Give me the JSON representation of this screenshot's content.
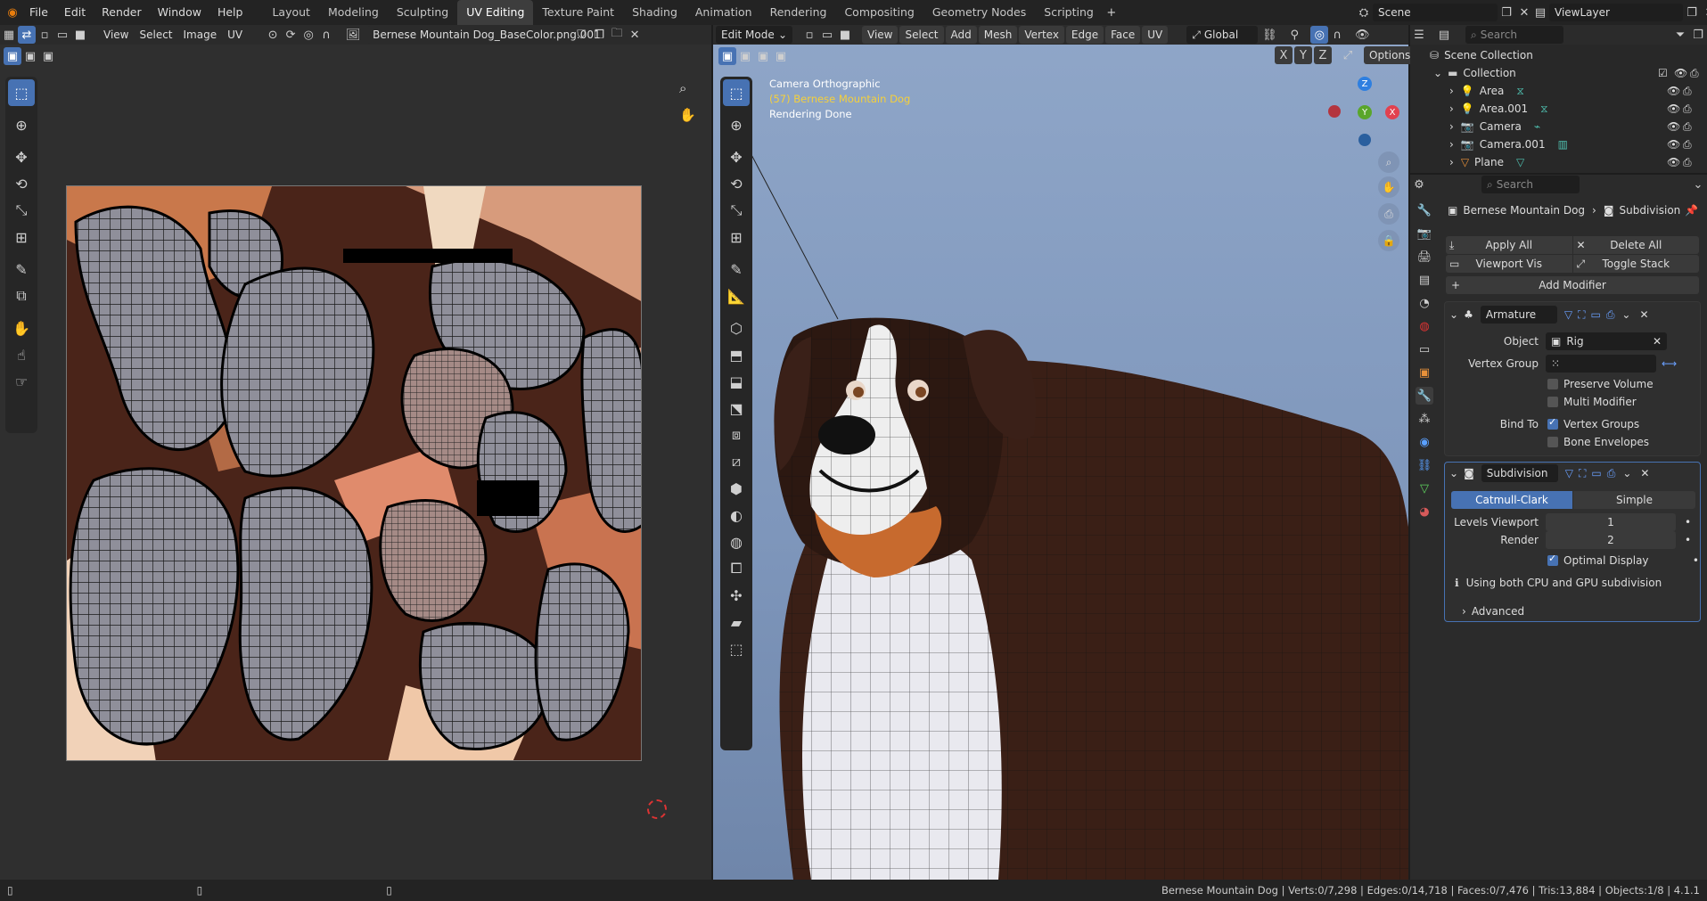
{
  "app": {
    "menus": [
      "File",
      "Edit",
      "Render",
      "Window",
      "Help"
    ],
    "workspaces": [
      "Layout",
      "Modeling",
      "Sculpting",
      "UV Editing",
      "Texture Paint",
      "Shading",
      "Animation",
      "Rendering",
      "Compositing",
      "Geometry Nodes",
      "Scripting"
    ],
    "active_workspace": "UV Editing",
    "scene": "Scene",
    "view_layer": "ViewLayer",
    "accent": "#4772b3"
  },
  "uv_editor": {
    "menus": [
      "View",
      "Select",
      "Image",
      "UV"
    ],
    "image_name": "Bernese Mountain Dog_BaseColor.png.001"
  },
  "viewport": {
    "mode": "Edit Mode",
    "menus": [
      "View",
      "Select",
      "Add",
      "Mesh",
      "Vertex",
      "Edge",
      "Face",
      "UV"
    ],
    "orientation": "Global",
    "options_label": "Options",
    "axes": [
      "X",
      "Y",
      "Z"
    ],
    "overlay_line1": "Camera Orthographic",
    "overlay_line2": "(57) Bernese Mountain Dog",
    "overlay_line3": "Rendering Done",
    "gizmo": {
      "x": "X",
      "y": "Y",
      "z": "Z"
    }
  },
  "outliner": {
    "search_placeholder": "Search",
    "root": "Scene Collection",
    "collection": "Collection",
    "items": [
      "Area",
      "Area.001",
      "Camera",
      "Camera.001",
      "Plane"
    ]
  },
  "properties": {
    "search_placeholder": "Search",
    "breadcrumb_object": "Bernese Mountain Dog",
    "breadcrumb_modifier": "Subdivision",
    "apply_all": "Apply All",
    "delete_all": "Delete All",
    "viewport_vis": "Viewport Vis",
    "toggle_stack": "Toggle Stack",
    "add_modifier": "Add Modifier",
    "armature": {
      "name": "Armature",
      "object_label": "Object",
      "object_value": "Rig",
      "vertex_group_label": "Vertex Group",
      "preserve_volume": "Preserve Volume",
      "multi_modifier": "Multi Modifier",
      "bind_to": "Bind To",
      "vertex_groups": "Vertex Groups",
      "bone_envelopes": "Bone Envelopes"
    },
    "subdivision": {
      "name": "Subdivision",
      "catmull": "Catmull-Clark",
      "simple": "Simple",
      "levels_viewport_label": "Levels Viewport",
      "levels_viewport": "1",
      "render_label": "Render",
      "render": "2",
      "optimal_display": "Optimal Display",
      "info": "Using both CPU and GPU subdivision",
      "advanced": "Advanced"
    }
  },
  "status": {
    "text": "Bernese Mountain Dog | Verts:0/7,298 | Edges:0/14,718 | Faces:0/7,476 | Tris:13,884 | Objects:1/8 | 4.1.1"
  }
}
